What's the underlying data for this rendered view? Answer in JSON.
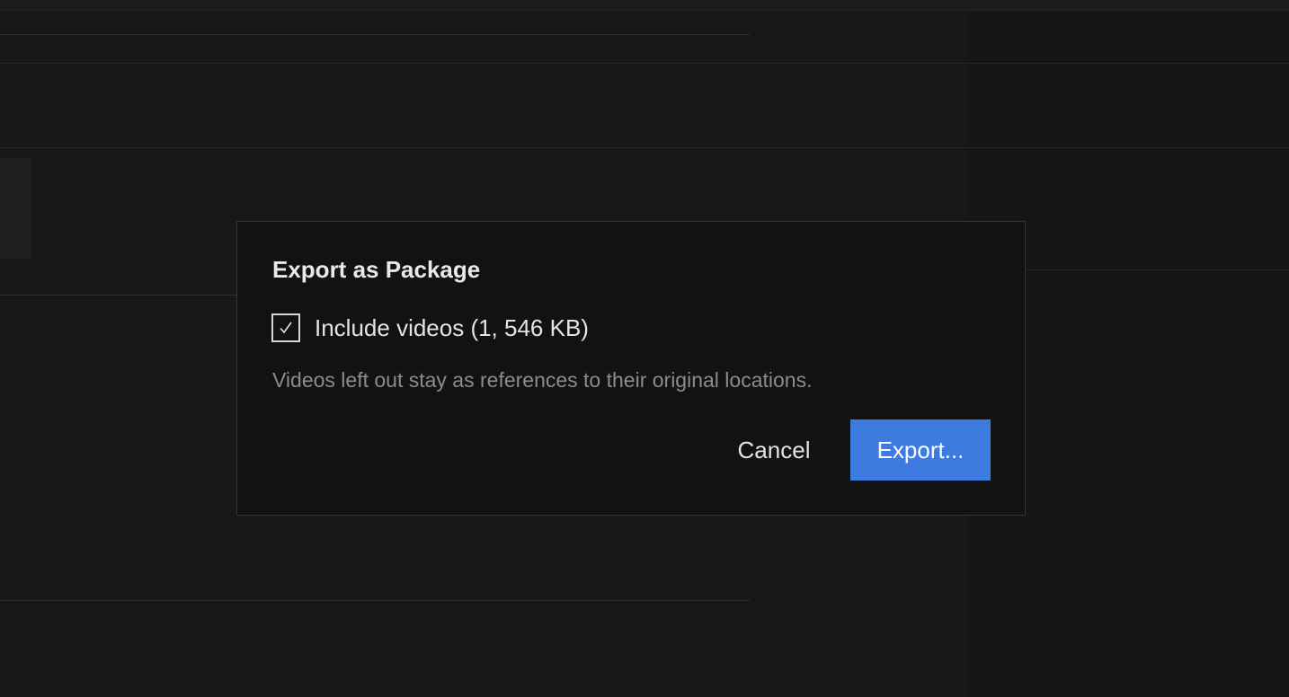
{
  "dialog": {
    "title": "Export as Package",
    "include_videos": {
      "label": "Include videos (1, 546 KB)",
      "checked": true
    },
    "hint": "Videos left out stay as references to their original locations.",
    "cancel_label": "Cancel",
    "export_label": "Export..."
  },
  "colors": {
    "background": "#181818",
    "dialog_background": "#121212",
    "accent": "#3d7be0"
  },
  "icons": {
    "checkbox_mark": "check-icon"
  }
}
